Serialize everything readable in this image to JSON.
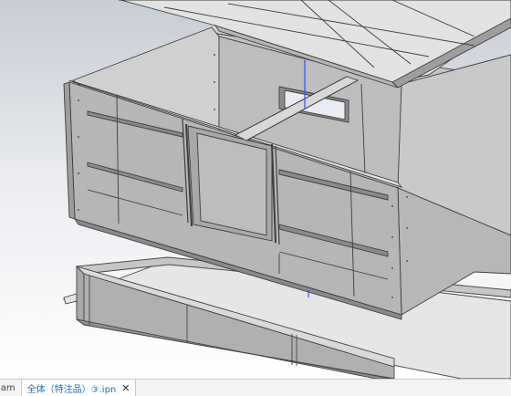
{
  "tabs": [
    {
      "label": "iam",
      "active": false
    },
    {
      "label": "全体（特注品）③.ipn",
      "active": true,
      "close_icon": "close-icon"
    }
  ],
  "colors": {
    "panel": "#b4b4b4",
    "panel_light": "#cfcfcf",
    "edge": "#404040",
    "bar": "#9a9a9a",
    "beam": "#d8d8d8",
    "axis_blue": "#2d4fff",
    "active_tab_text": "#1f6fb5"
  }
}
